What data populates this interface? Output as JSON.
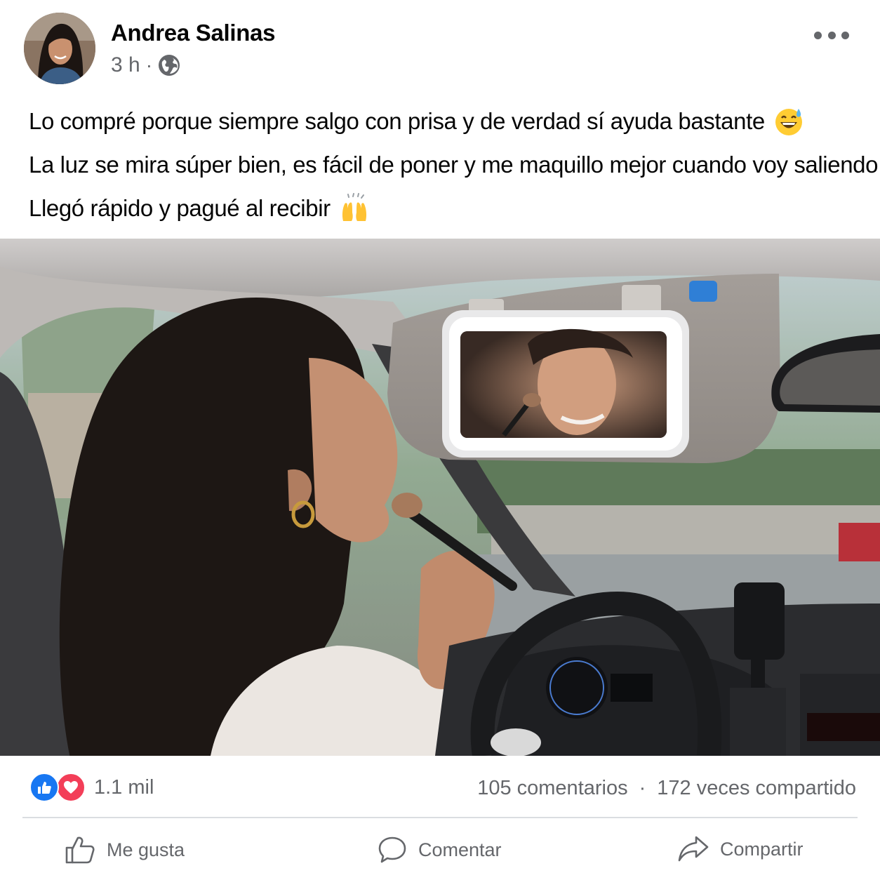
{
  "post": {
    "author": "Andrea Salinas",
    "time": "3 h",
    "separator": "·",
    "privacy_icon": "globe-icon",
    "lines": [
      "Lo compré porque siempre salgo con prisa y de verdad sí ayuda bastante",
      "La luz se mira súper bien, es fácil de poner y me maquillo mejor cuando voy saliendo.",
      "Llegó rápido y pagué al recibir"
    ],
    "emojis": [
      "grinning-sweat-emoji",
      "raising-hands-emoji"
    ]
  },
  "counts": {
    "reactions": "1.1 mil",
    "comments": "105 comentarios",
    "separator": "·",
    "shares": "172 veces compartido"
  },
  "actions": {
    "like": "Me gusta",
    "comment": "Comentar",
    "share": "Compartir"
  },
  "colors": {
    "accent": "#1877f2",
    "love": "#f33e58",
    "secondary_text": "#65676b"
  }
}
